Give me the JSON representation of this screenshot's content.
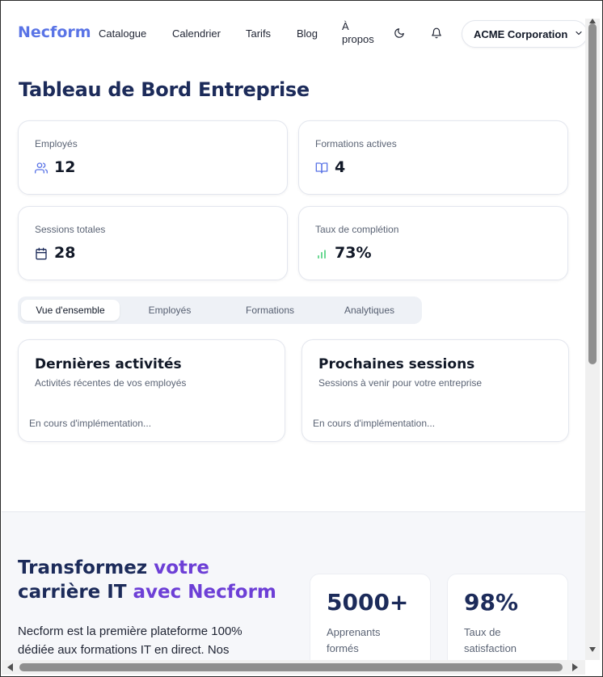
{
  "header": {
    "logo": "Necform",
    "nav": [
      {
        "label": "Catalogue"
      },
      {
        "label": "Calendrier"
      },
      {
        "label": "Tarifs"
      },
      {
        "label": "Blog"
      },
      {
        "label": "À propos"
      }
    ],
    "theme_icon": "moon-icon",
    "notification_icon": "bell-icon",
    "company_selector": "ACME Corporation"
  },
  "page_title": "Tableau de Bord Entreprise",
  "stats": [
    {
      "label": "Employés",
      "value": "12",
      "icon": "users-icon"
    },
    {
      "label": "Formations actives",
      "value": "4",
      "icon": "book-open-icon"
    },
    {
      "label": "Sessions totales",
      "value": "28",
      "icon": "calendar-icon"
    },
    {
      "label": "Taux de complétion",
      "value": "73%",
      "icon": "bar-chart-icon"
    }
  ],
  "tabs": [
    {
      "label": "Vue d'ensemble",
      "active": true
    },
    {
      "label": "Employés",
      "active": false
    },
    {
      "label": "Formations",
      "active": false
    },
    {
      "label": "Analytiques",
      "active": false
    }
  ],
  "panels": [
    {
      "title": "Dernières activités",
      "subtitle": "Activités récentes de vos employés",
      "content": "En cours d'implémentation..."
    },
    {
      "title": "Prochaines sessions",
      "subtitle": "Sessions à venir pour votre entreprise",
      "content": "En cours d'implémentation..."
    }
  ],
  "promo": {
    "title_part1": "Transformez ",
    "title_accent1": "votre",
    "title_part2": "carrière IT ",
    "title_accent2": "avec Necform",
    "text": "Necform est la première plateforme 100% dédiée aux formations IT en direct. Nos",
    "stats": [
      {
        "value": "5000+",
        "label": "Apprenants formés"
      },
      {
        "value": "98%",
        "label": "Taux de satisfaction"
      }
    ]
  },
  "colors": {
    "brand": "#5a74e6",
    "title": "#1c2b5a",
    "accent": "#6d3fd6",
    "success": "#22c55e"
  }
}
